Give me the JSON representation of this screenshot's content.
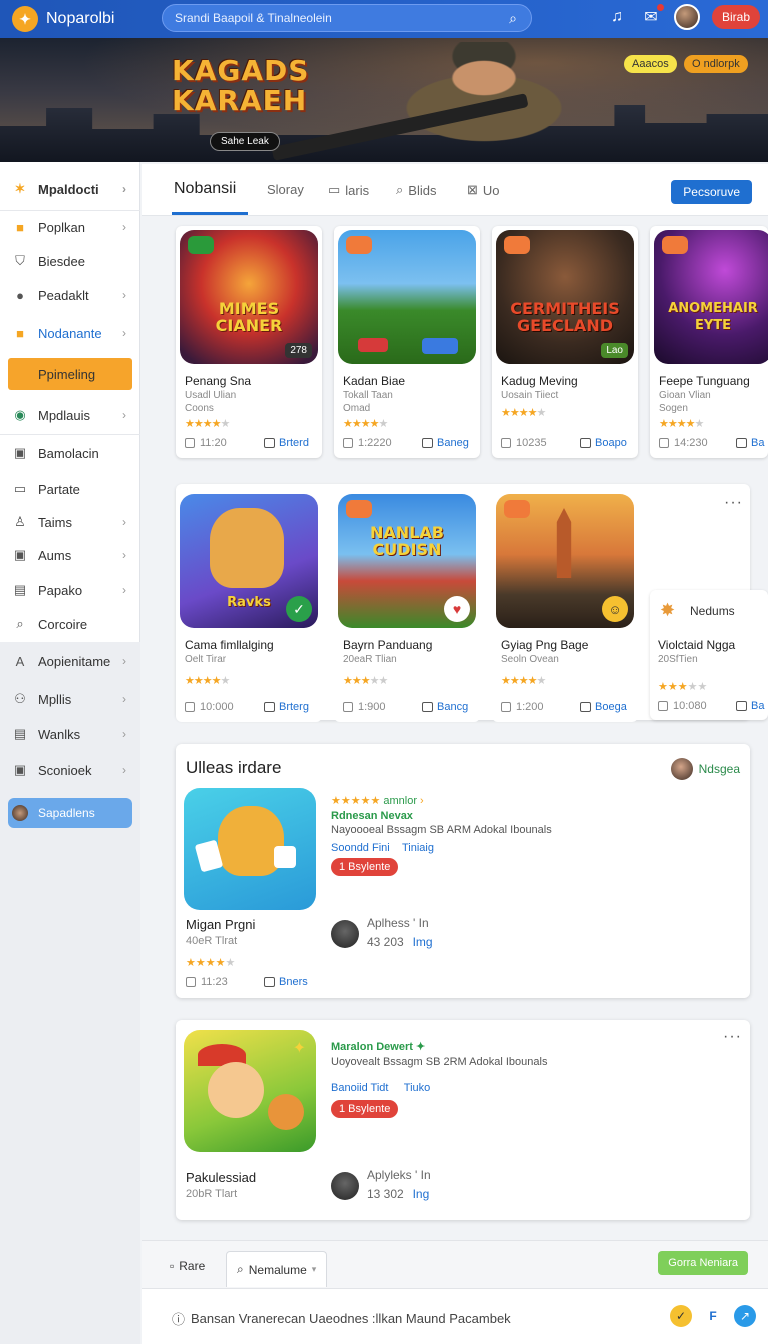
{
  "app": {
    "title": "Noparolbi",
    "logo": "logo-icon"
  },
  "search": {
    "placeholder": "Srandi Baapoil & Tinalneolein"
  },
  "header": {
    "login_label": "Birab"
  },
  "banner": {
    "title_line1": "KAGADS",
    "title_line2": "KARAEH",
    "button": "Sahe Leak",
    "tag1": "Aaacos",
    "tag2": "O ndlorpk"
  },
  "sidebar": {
    "items": [
      {
        "label": "Mpaldocti",
        "icon": "star-icon"
      },
      {
        "label": "Poplkan",
        "icon": "briefcase-icon"
      },
      {
        "label": "Biesdee",
        "icon": "shield-icon"
      },
      {
        "label": "Peadaklt",
        "icon": "circle-icon"
      },
      {
        "label": "Nodanante",
        "icon": "briefcase-icon"
      },
      {
        "label": "Ppimeling",
        "icon": ""
      },
      {
        "label": "Mpdlauis",
        "icon": "globe-icon"
      },
      {
        "label": "Bamolacin",
        "icon": "square-icon"
      },
      {
        "label": "Partate",
        "icon": "folder-icon"
      },
      {
        "label": "Taims",
        "icon": "person-icon"
      },
      {
        "label": "Aums",
        "icon": "image-icon"
      },
      {
        "label": "Papako",
        "icon": "document-icon"
      },
      {
        "label": "Corcoire",
        "icon": "search-icon"
      },
      {
        "label": "Aopienitame",
        "icon": "letter-a-icon"
      },
      {
        "label": "Mpllis",
        "icon": "users-icon"
      },
      {
        "label": "Wanlks",
        "icon": "document-icon"
      },
      {
        "label": "Sconioek",
        "icon": "image-icon"
      },
      {
        "label": "Sapadlens",
        "icon": "avatar"
      }
    ]
  },
  "tabs": {
    "items": [
      {
        "label": "Nobansii"
      },
      {
        "label": "Sloray"
      },
      {
        "label": "laris",
        "icon": "window-icon"
      },
      {
        "label": "Blids",
        "icon": "search-icon"
      },
      {
        "label": "Uo",
        "icon": "close-icon"
      }
    ],
    "button": "Pecsoruve"
  },
  "cards_row1": [
    {
      "title": "Penang Sna",
      "sub": "Usadl Ulian",
      "sub2": "Coons",
      "stars": 4,
      "count": "11:20",
      "action": "Brterd",
      "img_text": "MIMES CIANER",
      "corner": "278"
    },
    {
      "title": "Kadan Biae",
      "sub": "Tokall Taan",
      "sub2": "Omad",
      "stars": 4,
      "count": "1:2220",
      "action": "Baneg",
      "img_text": "",
      "corner": ""
    },
    {
      "title": "Kadug Meving",
      "sub": "Uosain Tiiect",
      "sub2": "",
      "stars": 4,
      "count": "10235",
      "action": "Boapo",
      "img_text": "CERMITHEIS GEECLAND",
      "corner": "Lao"
    },
    {
      "title": "Feepe Tunguang",
      "sub": "Gioan Vlian",
      "sub2": "Sogen",
      "stars": 4,
      "count": "14:230",
      "action": "Ba",
      "img_text": "ANOMEHAIR EYTE",
      "corner": ""
    }
  ],
  "cards_row2": [
    {
      "title": "Cama fimllalging",
      "sub": "Oelt Tirar",
      "stars": 4,
      "count": "10:000",
      "action": "Brterg",
      "img_text": "Ravks"
    },
    {
      "title": "Bayrn Panduang",
      "sub": "20eaR Tlian",
      "stars": 3,
      "count": "1:900",
      "action": "Bancg",
      "img_text": "NANLAB CUDISN"
    },
    {
      "title": "Gyiag Png Bage",
      "sub": "Seoln Ovean",
      "stars": 4,
      "count": "1:200",
      "action": "Boega",
      "img_text": ""
    }
  ],
  "side_card": {
    "title": "Violctaid Ngga",
    "sub": "20SfTien",
    "count": "10:080",
    "action": "Ba",
    "stars": 3,
    "head": "Nedums"
  },
  "featured1": {
    "heading": "Ulleas irdare",
    "user": "Ndsgea",
    "title": "Migan Prgni",
    "sub": "40eR Tlrat",
    "count": "11:23",
    "action": "Bners",
    "rating_text": "amnlor",
    "meta1": "Rdnesan Nevax",
    "meta2": "Nayoooeal Bssagm SB ARM Adokal Ibounals",
    "meta3a": "Soondd Fini",
    "meta3b": "Tiniaig",
    "pill": "1 Bsylente",
    "dev_name": "Aplhess ' In",
    "dev_num": "43 203",
    "dev_link": "Img"
  },
  "featured2": {
    "title": "Pakulessiad",
    "sub": "20bR Tlart",
    "meta1": "Maralon Dewert",
    "meta2": "Uoyovealt Bssagm SB 2RM Adokal Ibounals",
    "meta3a": "Banoiid Tidt",
    "meta3b": "Tiuko",
    "pill": "1 Bsylente",
    "dev_name": "Aplyleks ' In",
    "dev_num": "13 302",
    "dev_link": "Ing"
  },
  "bottom_tabs": {
    "tab1": "Rare",
    "tab2": "Nemalume",
    "button": "Gorra Neniara"
  },
  "footer": {
    "text": "Bansan Vranerecan Uaeodnes :llkan Maund Pacambek"
  },
  "colors": {
    "primary": "#1f6fd0",
    "topbar": "#2a6ad6",
    "accent": "#f6a42b",
    "danger": "#e0433a",
    "success": "#7fcf5a"
  }
}
